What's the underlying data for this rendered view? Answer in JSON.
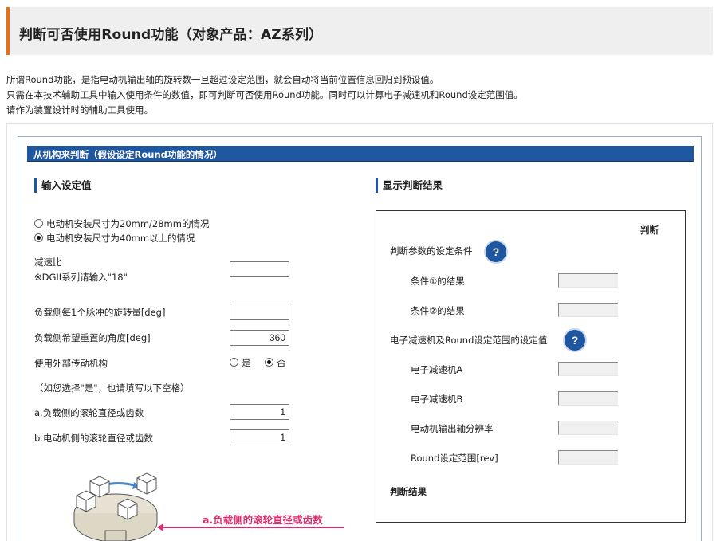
{
  "page": {
    "title": "判断可否使用Round功能（对象产品：AZ系列）",
    "intro_lines": [
      "所谓Round功能，是指电动机输出轴的旋转数一旦超过设定范围，就会自动将当前位置信息回归到预设值。",
      "只需在本技术辅助工具中输入使用条件的数值，即可判断可否使用Round功能。同时可以计算电子减速机和Round设定范围值。",
      "请作为装置设计时的辅助工具使用。"
    ]
  },
  "section": {
    "header": "从机构来判断（假设设定Round功能的情况）"
  },
  "input": {
    "heading": "输入设定值",
    "radio_20_28": "电动机安装尺寸为20mm/28mm的情况",
    "radio_40": "电动机安装尺寸为40mm以上的情况",
    "selected_size": "40mm",
    "gear_ratio_label": "减速比",
    "gear_ratio_note": "※DGII系列请输入\"18\"",
    "gear_ratio_value": "",
    "rotation_per_pulse_label": "负载侧每1个脉冲的旋转量[deg]",
    "rotation_per_pulse_value": "",
    "reset_angle_label": "负载侧希望重置的角度[deg]",
    "reset_angle_value": "360",
    "external_mech_label": "使用外部传动机构",
    "yes_label": "是",
    "no_label": "否",
    "external_selected": "否",
    "hint": "（如您选择\"是\"，也请填写以下空格）",
    "load_roller_label": "a.负载侧的滚轮直径或齿数",
    "load_roller_value": "1",
    "motor_roller_label": "b.电动机侧的滚轮直径或齿数",
    "motor_roller_value": "1",
    "illustration_annotation": "a.负载侧的滚轮直径或齿数"
  },
  "result": {
    "heading": "显示判断结果",
    "judge_col_header": "判断",
    "conditions_label": "判断参数的设定条件",
    "condition1_label": "条件①的结果",
    "condition2_label": "条件②的结果",
    "settings_label": "电子减速机及Round设定范围的设定值",
    "gear_a_label": "电子减速机A",
    "gear_b_label": "电子减速机B",
    "resolution_label": "电动机输出轴分辨率",
    "round_range_label": "Round设定范围[rev]",
    "final_label": "判断结果",
    "help_icon_glyph": "?"
  },
  "colors": {
    "accent_orange": "#e8701a",
    "header_blue": "#1e56a0",
    "annotation_pink": "#d8306e"
  }
}
